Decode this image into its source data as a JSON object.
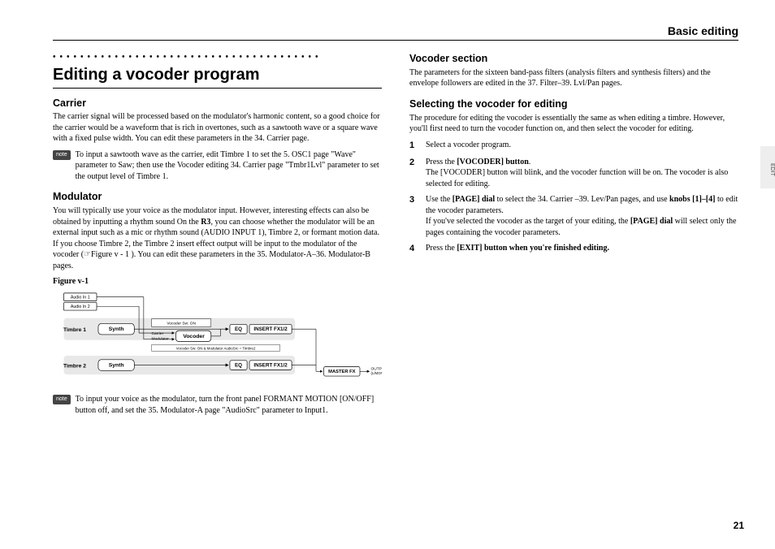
{
  "header_right": "Basic editing",
  "side_tab": "EDIT",
  "page_number": "21",
  "left": {
    "title": "Editing a vocoder program",
    "carrier_h": "Carrier",
    "carrier_p": "The carrier signal will be processed based on the modulator's harmonic content, so a good choice for the carrier would be a waveform that is rich in overtones, such as a sawtooth wave or a square wave with a fixed pulse width. You can edit these parameters in the 34. Carrier page.",
    "carrier_note": "To input a sawtooth wave as the carrier, edit Timbre 1 to set the 5. OSC1 page \"Wave\" parameter to Saw; then use the Vocoder editing 34. Carrier page \"Tmbr1Lvl\" parameter to set the output level of Timbre 1.",
    "mod_h": "Modulator",
    "mod_p1a": "You will typically use your voice as the modulator input. However, interesting effects can also be obtained by inputting a rhythm sound On the ",
    "mod_p1b": "R3",
    "mod_p1c": ", you can choose whether the modulator will be an external input such as a mic or rhythm sound (AUDIO INPUT 1), Timbre 2, or formant motion data. If you choose Timbre 2, the Timbre 2 insert effect output will be input to the modulator of the vocoder (☞Figure v - 1 ). You can edit these parameters in the 35. Modulator-A–36. Modulator-B pages.",
    "fig_title": "Figure v-1",
    "mod_note": "To input your voice as the modulator, turn the front panel FORMANT MOTION [ON/OFF] button off, and set the 35. Modulator-A page \"AudioSrc\" parameter to Input1."
  },
  "right": {
    "vsec_h": "Vocoder section",
    "vsec_p": "The parameters for the sixteen band-pass filters (analysis filters and synthesis filters) and the envelope followers are edited in the 37. Filter–39. Lvl/Pan pages.",
    "sel_h": "Selecting the vocoder for editing",
    "sel_p": "The procedure for editing the vocoder is essentially the same as when editing a timbre. However, you'll first need to turn the vocoder function on, and then select the vocoder for editing.",
    "step1": "Select a vocoder program.",
    "step2a": "Press the ",
    "step2b": "[VOCODER] button",
    "step2c": ".",
    "step2d": "The [VOCODER] button will blink, and the vocoder function will be on. The vocoder is also selected for editing.",
    "step3a": "Use the ",
    "step3b": "[PAGE] dial",
    "step3c": " to select the 34. Carrier –39. Lev/Pan pages, and use ",
    "step3d": "knobs [1]–[4]",
    "step3e": " to edit the vocoder parameters.",
    "step3f": "If you've selected the vocoder as the target of your editing, the ",
    "step3g": "[PAGE] dial",
    "step3h": " will select only the pages containing the vocoder parameters.",
    "step4a": "Press the ",
    "step4b": "[EXIT] button when you're finished editing."
  },
  "fig": {
    "audio_in1": "Audio In 1",
    "audio_in2": "Audio In 2",
    "timbre1": "Timbre 1",
    "timbre2": "Timbre 2",
    "synth": "Synth",
    "eq": "EQ",
    "insert": "INSERT FX1/2",
    "carrier": "Carrier",
    "modulator": "Modulator",
    "vocoder": "Vocoder",
    "vsw_on": "Vocoder Sw: ON",
    "vsw_note": "Vocoder Sw: ON & Modulator AudioSrc = Timbre2",
    "master": "MASTER FX",
    "output": "OUTPUT",
    "output2": "(L/MONO, R)"
  }
}
